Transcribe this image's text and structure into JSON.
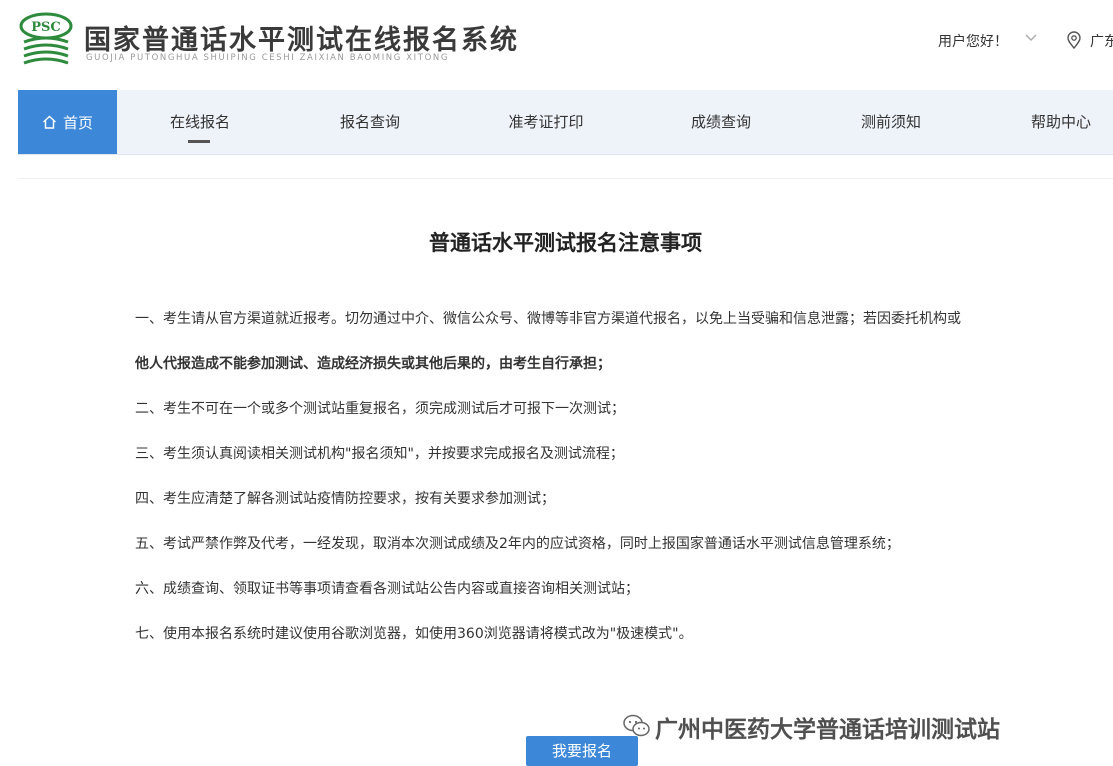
{
  "header": {
    "logo_text": "PSC",
    "title": "国家普通话水平测试在线报名系统",
    "subtitle_pinyin": "GUOJIA PUTONGHUA SHUIPING CESHI ZAIXIAN BAOMING XITONG",
    "greeting": "用户您好！",
    "region": "广东"
  },
  "nav": {
    "items": [
      "首页",
      "在线报名",
      "报名查询",
      "准考证打印",
      "成绩查询",
      "测前须知",
      "帮助中心"
    ],
    "active_index": 0,
    "underlined_index": 1
  },
  "notice": {
    "title": "普通话水平测试报名注意事项",
    "paragraphs": [
      "一、考生请从官方渠道就近报考。切勿通过中介、微信公众号、微博等非官方渠道代报名，以免上当受骗和信息泄露；若因委托机构或",
      "他人代报造成不能参加测试、造成经济损失或其他后果的，由考生自行承担；",
      "二、考生不可在一个或多个测试站重复报名，须完成测试后才可报下一次测试；",
      "三、考生须认真阅读相关测试机构\"报名须知\"，并按要求完成报名及测试流程；",
      "四、考生应清楚了解各测试站疫情防控要求，按有关要求参加测试；",
      "五、考试严禁作弊及代考，一经发现，取消本次测试成绩及2年内的应试资格，同时上报国家普通话水平测试信息管理系统；",
      "六、成绩查询、领取证书等事项请查看各测试站公告内容或直接咨询相关测试站；",
      "七、使用本报名系统时建议使用谷歌浏览器，如使用360浏览器请将模式改为\"极速模式\"。"
    ],
    "register_label": "我要报名"
  },
  "watermark": "广州中医药大学普通话培训测试站",
  "colors": {
    "accent": "#3d87d8",
    "nav_bg": "#eef2f9",
    "logo_green": "#2e8b3e"
  },
  "icons": [
    "psc-logo",
    "home-icon",
    "chevron-down-icon",
    "location-icon",
    "wechat-icon"
  ]
}
